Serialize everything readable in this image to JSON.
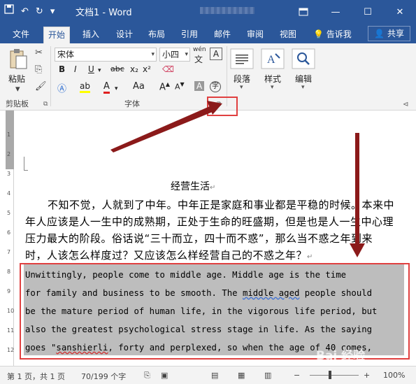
{
  "window": {
    "title": "文档1  -  Word",
    "quick_access": [
      "save-icon",
      "undo-icon",
      "redo-icon",
      "customize-icon"
    ],
    "controls": [
      "restore-icon",
      "minimize-icon",
      "maximize-icon",
      "close-icon"
    ]
  },
  "tabs": [
    "文件",
    "开始",
    "插入",
    "设计",
    "布局",
    "引用",
    "邮件",
    "审阅",
    "视图"
  ],
  "active_tab": "开始",
  "tell_me": "告诉我",
  "share": "共享",
  "ribbon": {
    "paste": "粘贴",
    "clipboard_label": "剪贴板",
    "font_name": "宋体",
    "font_size": "小四",
    "wen_label": "wén",
    "font_label": "字体",
    "paragraph_label": "段落",
    "styles_label": "样式",
    "editing_label": "编辑",
    "format_buttons": [
      "B",
      "I",
      "U",
      "abc",
      "x₂",
      "x²"
    ],
    "grow": "A",
    "shrink": "A",
    "aa": "Aa",
    "char_shade": "A",
    "enclose": "字"
  },
  "document": {
    "heading": "经营生活",
    "chinese_lines": [
      "不知不觉，人就到了中年。中年正是家庭和事业都是平稳的时候。本来中",
      "年人应该是人一生中的成熟期，正处于生命的旺盛期，但是也是人一生中心理",
      "压力最大的阶段。俗话说“三十而立，四十而不惑”，那么当不惑之年到来",
      "时，人该怎么样度过？又应该怎么样经营自己的不惑之年？"
    ],
    "english_lines": [
      "    Unwittingly, people come to middle age. Middle age is the time",
      "for family and business to be smooth. The middle aged people should",
      "be the mature period of human life, in the vigorous life period, but",
      "also the greatest psychological stress stage in life. As the saying",
      "goes \"sanshierli, forty and perplexed, so when the age of 40 comes,"
    ],
    "ruler_ticks": [
      "1",
      "2",
      "3",
      "4",
      "5",
      "6",
      "7",
      "8",
      "9",
      "10",
      "11",
      "12"
    ]
  },
  "status": {
    "page": "第 1 页，共 1 页",
    "words": "70/199 个字",
    "zoom": "100%"
  },
  "colors": {
    "brand": "#2b579a",
    "highlight_box": "#e04040",
    "arrow": "#8b1a1a"
  }
}
